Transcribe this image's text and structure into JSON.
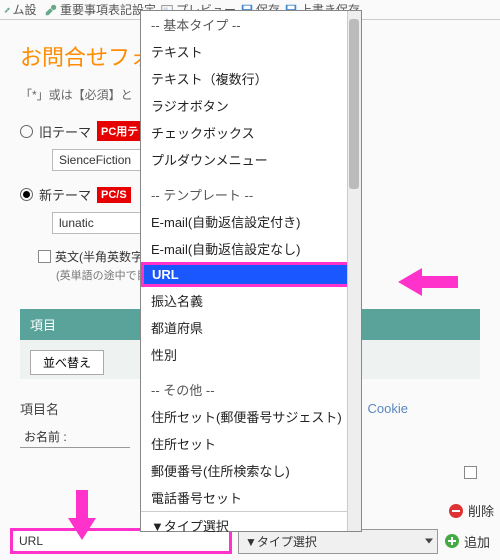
{
  "toolbar": {
    "item1": "ォーム設定",
    "item2": "重要事項表記設定",
    "item3": "プレビュー",
    "item4": "保存",
    "item5": "上書き保存"
  },
  "page": {
    "title": "お問合せフォ",
    "subnote": "「*」或は【必須】と"
  },
  "themes": {
    "old_label": "旧テーマ",
    "old_badge": "PC用テ",
    "old_value": "SienceFiction",
    "new_label": "新テーマ",
    "new_badge": "PC/S",
    "new_value": "lunatic",
    "chk_label": "英文(半角英数字)",
    "chk_note": "(英単語の途中で目"
  },
  "section": {
    "header": "項目",
    "sort_btn": "並べ替え",
    "name_label": "項目名",
    "name_value": "お名前 :",
    "cookie": "Cookie",
    "delete": "削除",
    "url_value": "URL",
    "type_select": "▼タイプ選択",
    "add": "追加"
  },
  "dropdown": {
    "items": [
      {
        "t": "-- 基本タイプ --",
        "g": true
      },
      {
        "t": "テキスト"
      },
      {
        "t": "テキスト（複数行）"
      },
      {
        "t": "ラジオボタン"
      },
      {
        "t": "チェックボックス"
      },
      {
        "t": "プルダウンメニュー"
      },
      {
        "t": "",
        "sp": true
      },
      {
        "t": "-- テンプレート --",
        "g": true
      },
      {
        "t": "E-mail(自動返信設定付き)"
      },
      {
        "t": "E-mail(自動返信設定なし)"
      },
      {
        "t": "URL",
        "sel": true
      },
      {
        "t": "振込名義"
      },
      {
        "t": "都道府県"
      },
      {
        "t": "性別"
      },
      {
        "t": "",
        "sp": true
      },
      {
        "t": "-- その他 --",
        "g": true
      },
      {
        "t": "住所セット(郵便番号サジェスト)"
      },
      {
        "t": "住所セット"
      },
      {
        "t": "郵便番号(住所検索なし)"
      },
      {
        "t": "電話番号セット"
      },
      {
        "t": "▼タイプ選択",
        "last": true
      }
    ]
  },
  "colors": {
    "accent": "#ff33cc",
    "select": "#1a57ff",
    "brand": "#ff8c00"
  }
}
